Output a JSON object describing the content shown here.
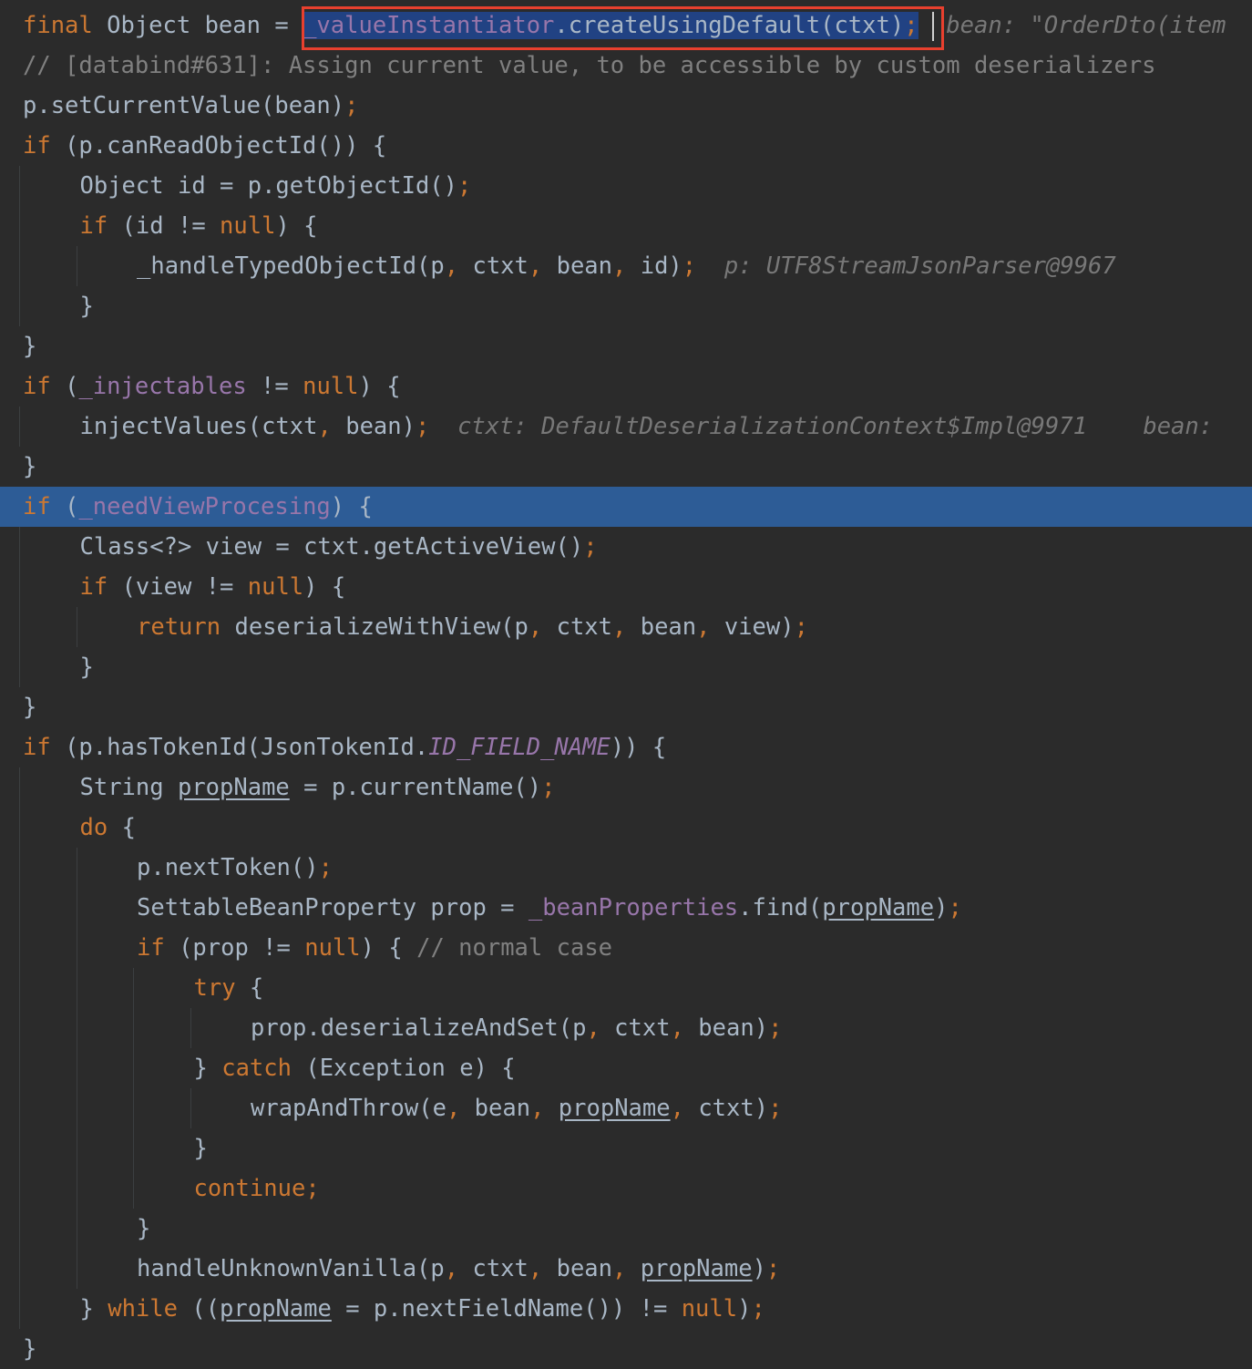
{
  "colors": {
    "background": "#2b2b2b",
    "execution_line": "#2d5c96",
    "selection": "#214283",
    "keyword": "#cc7832",
    "field": "#9876aa",
    "comment": "#808080",
    "default_text": "#a9b7c6",
    "annotation_box": "#e8402e"
  },
  "code_lines": [
    {
      "indent": 0,
      "tokens": [
        {
          "t": "final",
          "c": "kw"
        },
        {
          "t": " Object bean = "
        },
        {
          "t": "_valueInstantiator",
          "c": "fld sel"
        },
        {
          "t": ".createUsingDefault(ctxt)",
          "c": "sel"
        },
        {
          "t": ";",
          "c": "punc sel"
        },
        {
          "t": "  "
        },
        {
          "t": "bean: \"OrderDto(item",
          "c": "hint"
        }
      ]
    },
    {
      "indent": 0,
      "tokens": [
        {
          "t": "// [databind#631]: Assign current value, to be accessible by custom deserializers",
          "c": "cmt"
        }
      ]
    },
    {
      "indent": 0,
      "tokens": [
        {
          "t": "p.setCurrentValue(bean)"
        },
        {
          "t": ";",
          "c": "punc"
        }
      ]
    },
    {
      "indent": 0,
      "tokens": [
        {
          "t": "if",
          "c": "kw"
        },
        {
          "t": " (p.canReadObjectId()) {"
        }
      ]
    },
    {
      "indent": 1,
      "tokens": [
        {
          "t": "Object id = p.getObjectId()"
        },
        {
          "t": ";",
          "c": "punc"
        }
      ]
    },
    {
      "indent": 1,
      "tokens": [
        {
          "t": "if",
          "c": "kw"
        },
        {
          "t": " (id != "
        },
        {
          "t": "null",
          "c": "kw"
        },
        {
          "t": ") {"
        }
      ]
    },
    {
      "indent": 2,
      "tokens": [
        {
          "t": "_handleTypedObjectId(p"
        },
        {
          "t": ",",
          "c": "punc"
        },
        {
          "t": " ctxt"
        },
        {
          "t": ",",
          "c": "punc"
        },
        {
          "t": " bean"
        },
        {
          "t": ",",
          "c": "punc"
        },
        {
          "t": " id)"
        },
        {
          "t": ";",
          "c": "punc"
        },
        {
          "t": "  "
        },
        {
          "t": "p: UTF8StreamJsonParser@9967",
          "c": "hint"
        }
      ]
    },
    {
      "indent": 1,
      "tokens": [
        {
          "t": "}"
        }
      ]
    },
    {
      "indent": 0,
      "tokens": [
        {
          "t": "}"
        }
      ]
    },
    {
      "indent": 0,
      "tokens": [
        {
          "t": "if",
          "c": "kw"
        },
        {
          "t": " ("
        },
        {
          "t": "_injectables",
          "c": "fld"
        },
        {
          "t": " != "
        },
        {
          "t": "null",
          "c": "kw"
        },
        {
          "t": ") {"
        }
      ]
    },
    {
      "indent": 1,
      "tokens": [
        {
          "t": "injectValues(ctxt"
        },
        {
          "t": ",",
          "c": "punc"
        },
        {
          "t": " bean)"
        },
        {
          "t": ";",
          "c": "punc"
        },
        {
          "t": "  "
        },
        {
          "t": "ctxt: DefaultDeserializationContext$Impl@9971",
          "c": "hint"
        },
        {
          "t": "    "
        },
        {
          "t": "bean: ",
          "c": "hint"
        }
      ]
    },
    {
      "indent": 0,
      "tokens": [
        {
          "t": "}"
        }
      ]
    },
    {
      "indent": 0,
      "highlight": true,
      "tokens": [
        {
          "t": "if",
          "c": "kw"
        },
        {
          "t": " ("
        },
        {
          "t": "_needViewProcesing",
          "c": "fld"
        },
        {
          "t": ") {"
        }
      ]
    },
    {
      "indent": 1,
      "tokens": [
        {
          "t": "Class<?> view = ctxt.getActiveView()"
        },
        {
          "t": ";",
          "c": "punc"
        }
      ]
    },
    {
      "indent": 1,
      "tokens": [
        {
          "t": "if",
          "c": "kw"
        },
        {
          "t": " (view != "
        },
        {
          "t": "null",
          "c": "kw"
        },
        {
          "t": ") {"
        }
      ]
    },
    {
      "indent": 2,
      "tokens": [
        {
          "t": "return",
          "c": "kw"
        },
        {
          "t": " deserializeWithView(p"
        },
        {
          "t": ",",
          "c": "punc"
        },
        {
          "t": " ctxt"
        },
        {
          "t": ",",
          "c": "punc"
        },
        {
          "t": " bean"
        },
        {
          "t": ",",
          "c": "punc"
        },
        {
          "t": " view)"
        },
        {
          "t": ";",
          "c": "punc"
        }
      ]
    },
    {
      "indent": 1,
      "tokens": [
        {
          "t": "}"
        }
      ]
    },
    {
      "indent": 0,
      "tokens": [
        {
          "t": "}"
        }
      ]
    },
    {
      "indent": 0,
      "tokens": [
        {
          "t": "if",
          "c": "kw"
        },
        {
          "t": " (p.hasTokenId(JsonTokenId."
        },
        {
          "t": "ID_FIELD_NAME",
          "c": "sfld"
        },
        {
          "t": ")) {"
        }
      ]
    },
    {
      "indent": 1,
      "tokens": [
        {
          "t": "String "
        },
        {
          "t": "propName",
          "c": "ul"
        },
        {
          "t": " = p.currentName()"
        },
        {
          "t": ";",
          "c": "punc"
        }
      ]
    },
    {
      "indent": 1,
      "tokens": [
        {
          "t": "do",
          "c": "kw"
        },
        {
          "t": " {"
        }
      ]
    },
    {
      "indent": 2,
      "tokens": [
        {
          "t": "p.nextToken()"
        },
        {
          "t": ";",
          "c": "punc"
        }
      ]
    },
    {
      "indent": 2,
      "tokens": [
        {
          "t": "SettableBeanProperty prop = "
        },
        {
          "t": "_beanProperties",
          "c": "fld"
        },
        {
          "t": ".find("
        },
        {
          "t": "propName",
          "c": "ul"
        },
        {
          "t": ")"
        },
        {
          "t": ";",
          "c": "punc"
        }
      ]
    },
    {
      "indent": 2,
      "tokens": [
        {
          "t": "if",
          "c": "kw"
        },
        {
          "t": " (prop != "
        },
        {
          "t": "null",
          "c": "kw"
        },
        {
          "t": ") { "
        },
        {
          "t": "// normal case",
          "c": "cmt"
        }
      ]
    },
    {
      "indent": 3,
      "tokens": [
        {
          "t": "try",
          "c": "kw"
        },
        {
          "t": " {"
        }
      ]
    },
    {
      "indent": 4,
      "tokens": [
        {
          "t": "prop.deserializeAndSet(p"
        },
        {
          "t": ",",
          "c": "punc"
        },
        {
          "t": " ctxt"
        },
        {
          "t": ",",
          "c": "punc"
        },
        {
          "t": " bean)"
        },
        {
          "t": ";",
          "c": "punc"
        }
      ]
    },
    {
      "indent": 3,
      "tokens": [
        {
          "t": "} "
        },
        {
          "t": "catch",
          "c": "kw"
        },
        {
          "t": " (Exception e) {"
        }
      ]
    },
    {
      "indent": 4,
      "tokens": [
        {
          "t": "wrapAndThrow(e"
        },
        {
          "t": ",",
          "c": "punc"
        },
        {
          "t": " bean"
        },
        {
          "t": ",",
          "c": "punc"
        },
        {
          "t": " "
        },
        {
          "t": "propName",
          "c": "ul"
        },
        {
          "t": ",",
          "c": "punc"
        },
        {
          "t": " ctxt)"
        },
        {
          "t": ";",
          "c": "punc"
        }
      ]
    },
    {
      "indent": 3,
      "tokens": [
        {
          "t": "}"
        }
      ]
    },
    {
      "indent": 3,
      "tokens": [
        {
          "t": "continue",
          "c": "kw"
        },
        {
          "t": ";",
          "c": "punc"
        }
      ]
    },
    {
      "indent": 2,
      "tokens": [
        {
          "t": "}"
        }
      ]
    },
    {
      "indent": 2,
      "tokens": [
        {
          "t": "handleUnknownVanilla(p"
        },
        {
          "t": ",",
          "c": "punc"
        },
        {
          "t": " ctxt"
        },
        {
          "t": ",",
          "c": "punc"
        },
        {
          "t": " bean"
        },
        {
          "t": ",",
          "c": "punc"
        },
        {
          "t": " "
        },
        {
          "t": "propName",
          "c": "ul"
        },
        {
          "t": ")"
        },
        {
          "t": ";",
          "c": "punc"
        }
      ]
    },
    {
      "indent": 1,
      "tokens": [
        {
          "t": "} "
        },
        {
          "t": "while",
          "c": "kw"
        },
        {
          "t": " (("
        },
        {
          "t": "propName",
          "c": "ul"
        },
        {
          "t": " = p.nextFieldName()) != "
        },
        {
          "t": "null",
          "c": "kw"
        },
        {
          "t": ")"
        },
        {
          "t": ";",
          "c": "punc"
        }
      ]
    },
    {
      "indent": 0,
      "tokens": [
        {
          "t": "}"
        }
      ]
    }
  ]
}
